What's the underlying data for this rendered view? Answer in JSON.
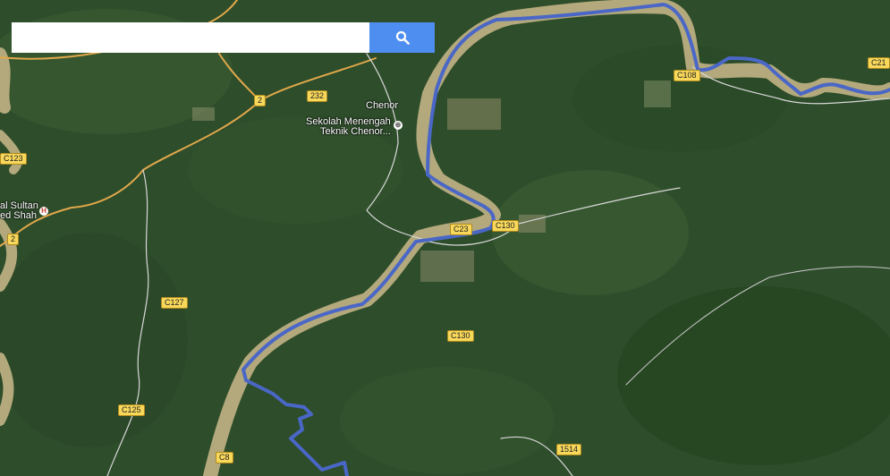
{
  "search": {
    "value": "",
    "placeholder": ""
  },
  "icons": {
    "search": "search-icon",
    "hospital": "hospital-icon",
    "school": "school-icon"
  },
  "colors": {
    "route": "#4a67c7",
    "shield": "#f8d85a",
    "search_button": "#4e8ef0"
  },
  "places": {
    "town": "Chenor",
    "school_line1": "Sekolah Menengah",
    "school_line2": "Teknik Chenor...",
    "hospital_line1": "al Sultan",
    "hospital_line2": "ed Shah"
  },
  "road_shields": {
    "r2_top": "2",
    "r232": "232",
    "r2_left": "2",
    "c123": "C123",
    "c108": "C108",
    "c21": "C21",
    "c23": "C23",
    "c130_river": "C130",
    "c127": "C127",
    "c130_mid": "C130",
    "c125": "C125",
    "c8": "C8",
    "r1514": "1514"
  }
}
